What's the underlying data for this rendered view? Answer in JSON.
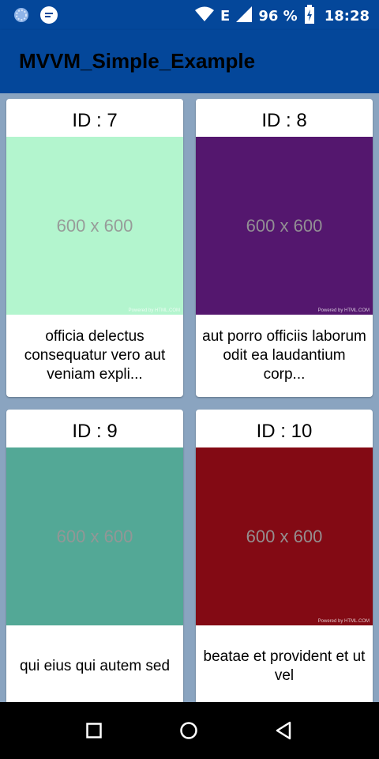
{
  "status_bar": {
    "network": "E",
    "battery_percent": "96 %",
    "time": "18:28"
  },
  "app_bar": {
    "title": "MVVM_Simple_Example"
  },
  "cards": [
    {
      "id_label": "ID : 7",
      "image_label": "600 x 600",
      "powered": "Powered by HTML.COM",
      "title": "officia delectus consequatur vero aut veniam expli...",
      "color": "#b3f5ce"
    },
    {
      "id_label": "ID : 8",
      "image_label": "600 x 600",
      "powered": "Powered by HTML.COM",
      "title": "aut porro officiis laborum odit ea laudantium corp...",
      "color": "#54176e"
    },
    {
      "id_label": "ID : 9",
      "image_label": "600 x 600",
      "powered": "",
      "title": "qui eius qui autem sed",
      "color": "#53a896"
    },
    {
      "id_label": "ID : 10",
      "image_label": "600 x 600",
      "powered": "Powered by HTML.COM",
      "title": "beatae et provident et ut vel",
      "color": "#830a14"
    }
  ]
}
